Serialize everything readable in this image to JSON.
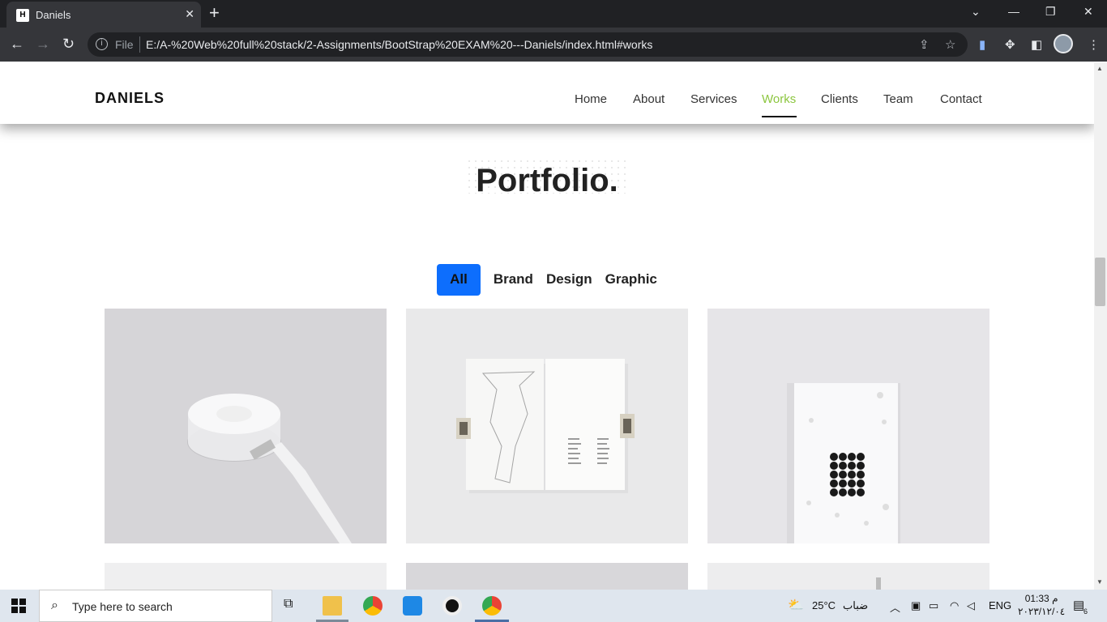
{
  "browser": {
    "tab_title": "Daniels",
    "favicon_letter": "H",
    "file_label": "File",
    "url": "E:/A-%20Web%20full%20stack/2-Assignments/BootStrap%20EXAM%20---Daniels/index.html#works"
  },
  "site": {
    "brand": "DANIELS",
    "nav": [
      "Home",
      "About",
      "Services",
      "Works",
      "Clients",
      "Team",
      "Contact"
    ],
    "active_nav": "Works",
    "accent_color": "#8cc63f"
  },
  "portfolio": {
    "title": "Portfolio.",
    "filters": [
      "All",
      "Brand",
      "Design",
      "Graphic"
    ],
    "active_filter": "All",
    "active_filter_color": "#0d6efd",
    "items": [
      {
        "image": "white charging puck with cable"
      },
      {
        "image": "open booklet with map held by clips"
      },
      {
        "image": "white card with black dot grid"
      }
    ]
  },
  "taskbar": {
    "search_placeholder": "Type here to search",
    "weather_temp": "25°C",
    "weather_text": "ضباب",
    "language": "ENG",
    "time": "01:33 م",
    "date": "٢٠٢٣/١٢/٠٤",
    "notification_count": "6"
  }
}
